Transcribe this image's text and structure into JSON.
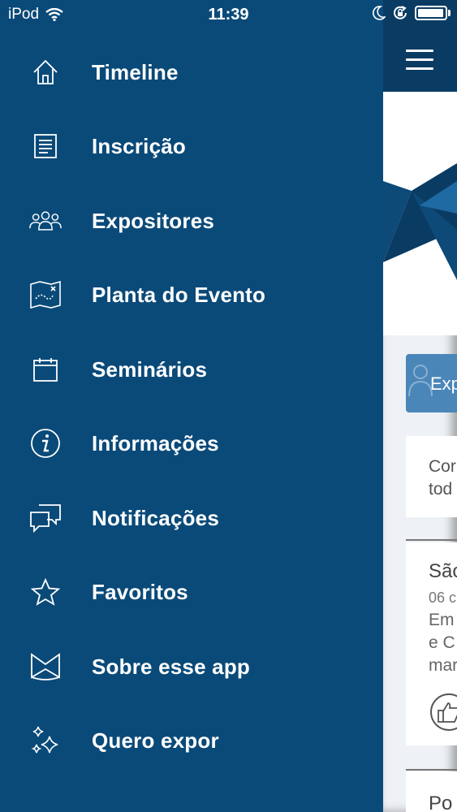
{
  "status_bar": {
    "device": "iPod",
    "time": "11:39"
  },
  "menu": {
    "items": [
      {
        "label": "Timeline",
        "icon": "home-icon"
      },
      {
        "label": "Inscrição",
        "icon": "document-icon"
      },
      {
        "label": "Expositores",
        "icon": "people-icon"
      },
      {
        "label": "Planta do Evento",
        "icon": "map-icon"
      },
      {
        "label": "Seminários",
        "icon": "calendar-icon"
      },
      {
        "label": "Informações",
        "icon": "info-icon"
      },
      {
        "label": "Notificações",
        "icon": "chat-icon"
      },
      {
        "label": "Favoritos",
        "icon": "star-icon"
      },
      {
        "label": "Sobre esse app",
        "icon": "logo-icon"
      },
      {
        "label": "Quero expor",
        "icon": "sparkle-icon"
      }
    ]
  },
  "content": {
    "expo_button_text": "Exp",
    "card1_line1": "Cor",
    "card1_line2": "tod",
    "card2_title": "São",
    "card2_line1": "06 c",
    "card2_line2": "Em",
    "card2_line3": "e C",
    "card2_line4": "mar",
    "card3_title": "Po"
  },
  "colors": {
    "menu_background": "#0a4a79",
    "top_bar": "#0a3c63",
    "expo_button": "#4a86b8"
  }
}
